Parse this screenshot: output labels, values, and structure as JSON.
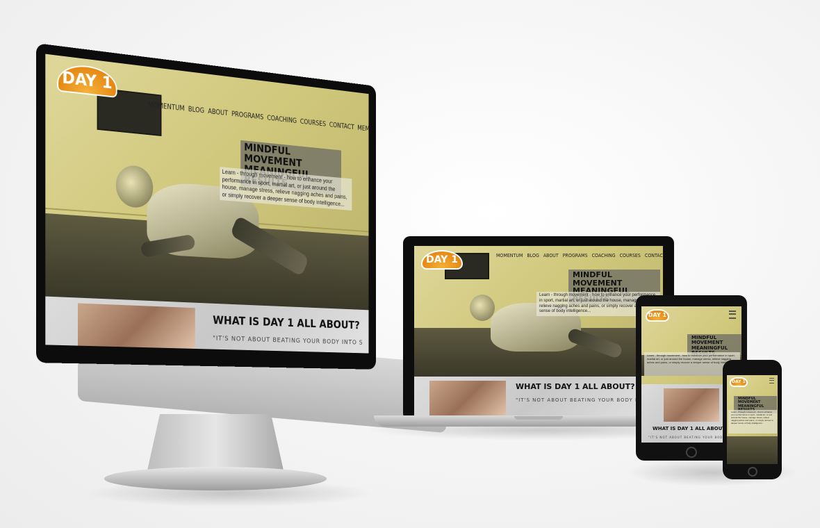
{
  "brand": {
    "logo_text": "DAY 1",
    "accent": "#e58a14",
    "hero_tint": "#d6cf86"
  },
  "nav": {
    "items": [
      "MOMENTUM",
      "BLOG",
      "ABOUT",
      "PROGRAMS",
      "COACHING",
      "COURSES",
      "CONTACT",
      "MEMBERS"
    ]
  },
  "hero": {
    "title_line1": "MINDFUL MOVEMENT",
    "title_line2": "MEANINGFUL RESULTS",
    "body": "Learn - through movement - how to enhance your performance in sport, martial art, or just around the house, manage stress, relieve nagging aches and pains, or simply recover a deeper sense of body intelligence..."
  },
  "about": {
    "heading": "WHAT IS DAY 1 ALL ABOUT?",
    "quote": "\"IT'S NOT ABOUT BEATING YOUR BODY INTO SHAPE AND FORCING CHANGE, BUT INSTEAD IT'S ABOUT..."
  },
  "tablet": {
    "menu_icon": "hamburger-icon"
  },
  "phone": {
    "menu_icon": "hamburger-icon"
  }
}
